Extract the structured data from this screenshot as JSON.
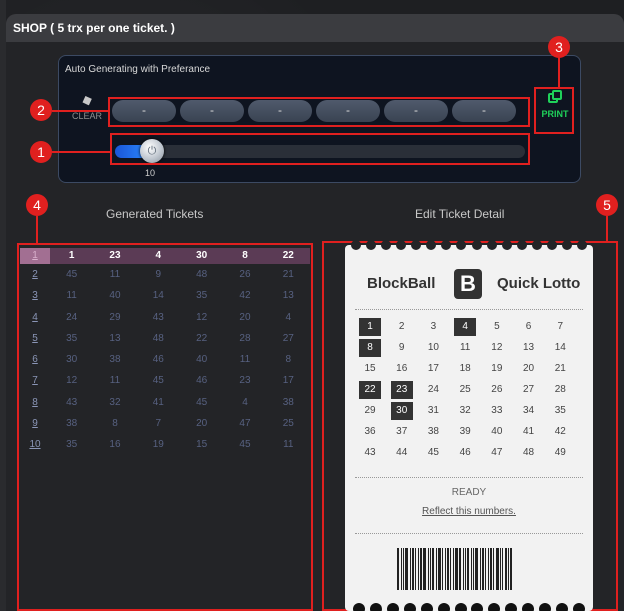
{
  "shop": {
    "title": "SHOP ( 5 trx per one ticket. )"
  },
  "auto_gen": {
    "title": "Auto Generating with Preferance",
    "clear_label": "CLEAR",
    "print_label": "PRINT",
    "slots": [
      "-",
      "-",
      "-",
      "-",
      "-",
      "-"
    ],
    "slider_value": "10",
    "slider_level_fraction": 0.09
  },
  "markers": {
    "m1": "1",
    "m2": "2",
    "m3": "3",
    "m4": "4",
    "m5": "5"
  },
  "columns": {
    "generated": "Generated Tickets",
    "edit": "Edit Ticket Detail"
  },
  "tickets": [
    {
      "idx": "1",
      "nums": [
        "1",
        "23",
        "4",
        "30",
        "8",
        "22"
      ]
    },
    {
      "idx": "2",
      "nums": [
        "45",
        "11",
        "9",
        "48",
        "26",
        "21"
      ]
    },
    {
      "idx": "3",
      "nums": [
        "11",
        "40",
        "14",
        "35",
        "42",
        "13"
      ]
    },
    {
      "idx": "4",
      "nums": [
        "24",
        "29",
        "43",
        "12",
        "20",
        "4"
      ]
    },
    {
      "idx": "5",
      "nums": [
        "35",
        "13",
        "48",
        "22",
        "28",
        "27"
      ]
    },
    {
      "idx": "6",
      "nums": [
        "30",
        "38",
        "46",
        "40",
        "11",
        "8"
      ]
    },
    {
      "idx": "7",
      "nums": [
        "12",
        "11",
        "45",
        "46",
        "23",
        "17"
      ]
    },
    {
      "idx": "8",
      "nums": [
        "43",
        "32",
        "41",
        "45",
        "4",
        "38"
      ]
    },
    {
      "idx": "9",
      "nums": [
        "38",
        "8",
        "7",
        "20",
        "47",
        "25"
      ]
    },
    {
      "idx": "10",
      "nums": [
        "35",
        "16",
        "19",
        "15",
        "45",
        "11"
      ]
    }
  ],
  "ticket_detail": {
    "brand_left": "BlockBall",
    "brand_logo": "B",
    "brand_right": "Quick Lotto",
    "numbers": [
      "1",
      "2",
      "3",
      "4",
      "5",
      "6",
      "7",
      "8",
      "9",
      "10",
      "11",
      "12",
      "13",
      "14",
      "15",
      "16",
      "17",
      "18",
      "19",
      "20",
      "21",
      "22",
      "23",
      "24",
      "25",
      "26",
      "27",
      "28",
      "29",
      "30",
      "31",
      "32",
      "33",
      "34",
      "35",
      "36",
      "37",
      "38",
      "39",
      "40",
      "41",
      "42",
      "43",
      "44",
      "45",
      "46",
      "47",
      "48",
      "49"
    ],
    "selected": [
      "1",
      "4",
      "8",
      "22",
      "23",
      "30"
    ],
    "status": "READY",
    "reflect_link": "Reflect this numbers."
  },
  "colors": {
    "accent_red": "#e0201f",
    "print_green": "#1fd15a",
    "slider_blue": "#2c8cff",
    "header_row": "#5b3b55"
  }
}
